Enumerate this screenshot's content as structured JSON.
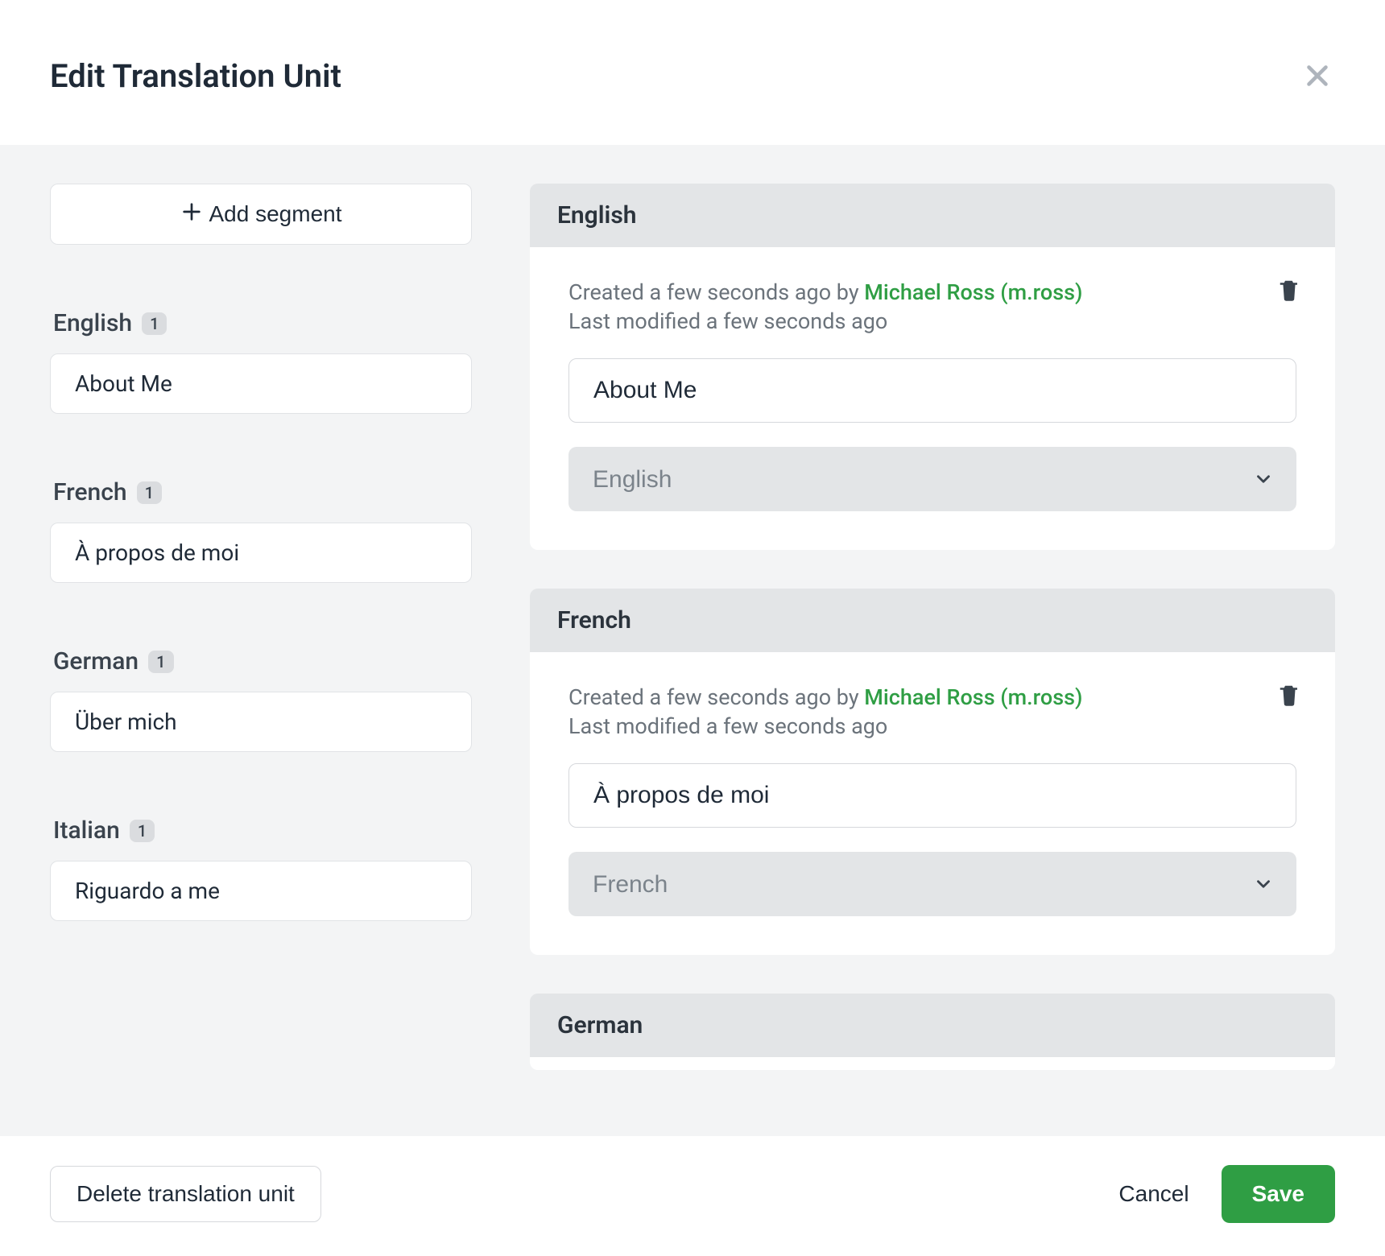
{
  "header": {
    "title": "Edit Translation Unit"
  },
  "sidebar": {
    "add_segment_label": "Add segment",
    "groups": [
      {
        "name": "English",
        "count": "1",
        "segment": "About Me"
      },
      {
        "name": "French",
        "count": "1",
        "segment": "À propos de moi"
      },
      {
        "name": "German",
        "count": "1",
        "segment": "Über mich"
      },
      {
        "name": "Italian",
        "count": "1",
        "segment": "Riguardo a me"
      }
    ]
  },
  "main": {
    "sections": [
      {
        "header": "English",
        "created_prefix": "Created a few seconds ago by ",
        "user": "Michael Ross (m.ross)",
        "modified": "Last modified a few seconds ago",
        "value": "About Me",
        "select": "English"
      },
      {
        "header": "French",
        "created_prefix": "Created a few seconds ago by ",
        "user": "Michael Ross (m.ross)",
        "modified": "Last modified a few seconds ago",
        "value": "À propos de moi",
        "select": "French"
      },
      {
        "header": "German"
      }
    ]
  },
  "footer": {
    "delete_unit": "Delete translation unit",
    "cancel": "Cancel",
    "save": "Save"
  }
}
